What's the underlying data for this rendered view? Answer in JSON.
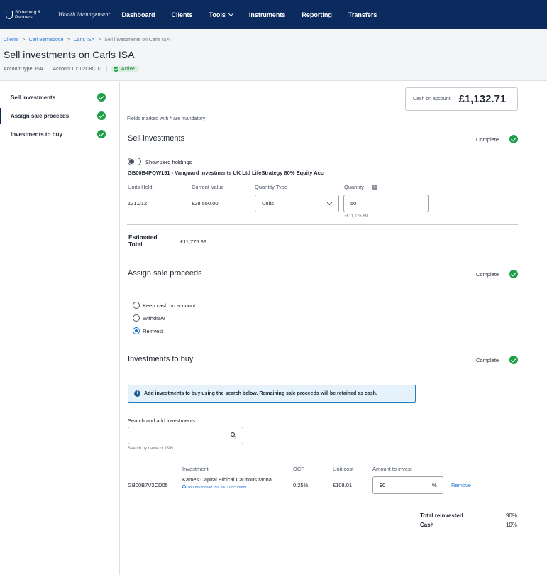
{
  "nav": {
    "brand": "Söderberg & Partners",
    "sub_brand": "Wealth Management",
    "items": [
      {
        "label": "Dashboard"
      },
      {
        "label": "Clients"
      },
      {
        "label": "Tools"
      },
      {
        "label": "Instruments"
      },
      {
        "label": "Reporting"
      },
      {
        "label": "Transfers"
      }
    ],
    "bg_color": "#0b2a5e"
  },
  "breadcrumb": {
    "items": [
      "Clients",
      "Carl Bernadotte",
      "Carls ISA"
    ],
    "current": "Sell investments on Carls ISA",
    "separator": ">"
  },
  "page": {
    "title": "Sell investments on Carls ISA",
    "account_type": "Account type: ISA",
    "account_id": "Account ID: 02C8CDJ",
    "divider": "|",
    "status": "Active"
  },
  "sidebar": {
    "items": [
      {
        "label": "Sell investments"
      },
      {
        "label": "Assign sale proceeds"
      },
      {
        "label": "Investments to buy"
      }
    ]
  },
  "cash": {
    "label": "Cash on account",
    "amount": "£1,132.71"
  },
  "mandatory_note": "Fields marked with * are mandatory",
  "sell": {
    "title": "Sell investments",
    "complete": "Complete",
    "toggle_label": "Show zero holdings",
    "fund": "GB00B4PQW151 - Vanguard Investments UK Ltd LifeStrategy 80% Equity Acc",
    "headers": {
      "units": "Units Held",
      "value": "Current Value",
      "qty_type": "Quantity Type",
      "qty": "Quantity"
    },
    "units": "121.212",
    "value": "£28,550.00",
    "qty_type": "Units",
    "qty": "50",
    "qty_hint": "~£11,776.89",
    "est_label": "Estimated Total",
    "est_value": "£11,776.89"
  },
  "assign": {
    "title": "Assign sale proceeds",
    "complete": "Complete",
    "options": [
      "Keep cash on account",
      "Withdraw",
      "Reinvest"
    ]
  },
  "buy": {
    "title": "Investments to buy",
    "complete": "Complete",
    "info": "Add investments to buy using the search below. Remaining sale proceeds will be retained as cash.",
    "search_label": "Search and add investments",
    "search_hint": "Search by name or ISIN",
    "headers": {
      "investment": "Investment",
      "ocf": "OCF",
      "unit_cost": "Unit cost",
      "amount": "Amount to invest"
    },
    "row": {
      "isin": "GB00B7V2CD05",
      "name": "Kames Capital Ethical Cautious Mona...",
      "kiid": "You must read this KIID document",
      "ocf": "0.25%",
      "unit_cost": "£108.01",
      "amount": "90",
      "unit": "%",
      "remove": "Remove"
    },
    "totals": [
      {
        "label": "Total reinvested",
        "value": "90%"
      },
      {
        "label": "Cash",
        "value": "10%"
      }
    ]
  }
}
